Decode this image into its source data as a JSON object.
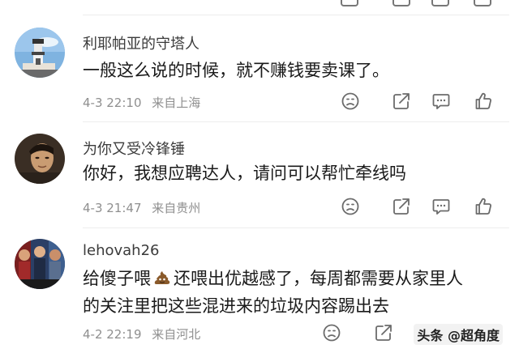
{
  "comments": [
    {
      "username": "利耶帕亚的守塔人",
      "text_lines": [
        "一般这么说的时候，就不赚钱要卖课了。"
      ],
      "date": "4-3 22:10",
      "location": "来自上海"
    },
    {
      "username": "为你又受冷锋锤",
      "text_lines": [
        "你好，我想应聘达人，请问可以帮忙牵线吗"
      ],
      "date": "4-3 21:47",
      "location": "来自贵州"
    },
    {
      "username": "lehovah26",
      "text_lines": [
        "给傻子喂",
        "还喂出优越感了，每周都需要从家里人",
        "的关注里把这些混进来的垃圾内容踢出去"
      ],
      "date": "4-2 22:19",
      "location": "来自河北"
    }
  ],
  "watermark": {
    "text": "头条 @超角度"
  },
  "icons": {
    "dislike": "thumbs-down-face-icon",
    "share": "share-icon",
    "reply": "comment-icon",
    "like": "thumbs-up-icon"
  },
  "colors": {
    "text": "#1a1a1a",
    "username": "#3b3b3b",
    "meta": "#8f8f8f",
    "icon": "#6b6b6b",
    "divider": "#ededed"
  }
}
